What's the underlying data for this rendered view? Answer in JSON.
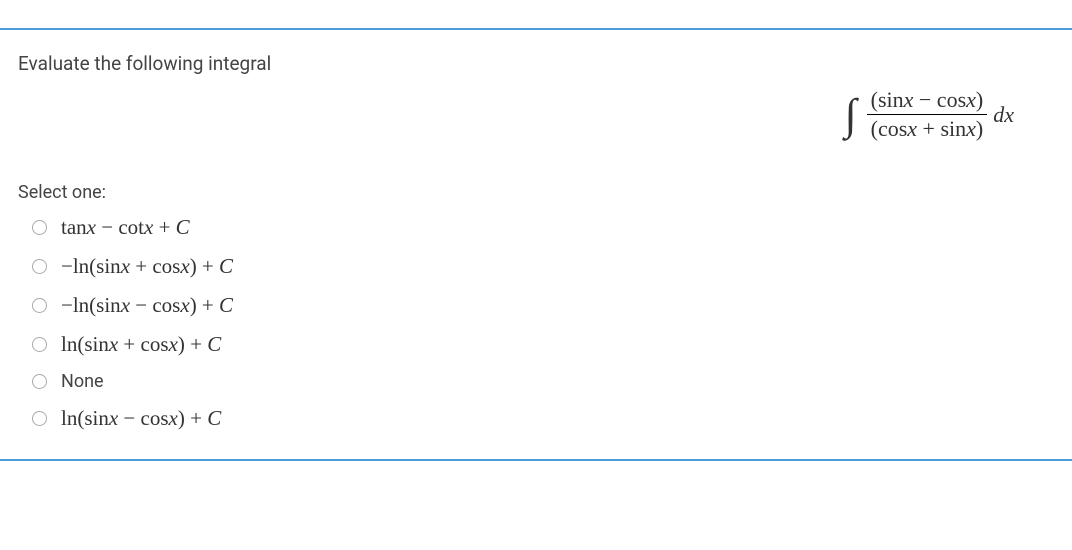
{
  "question": {
    "prompt": "Evaluate the following integral",
    "integral": {
      "numerator": "(sinx − cosx)",
      "denominator": "(cosx + sinx)",
      "differential": "dx"
    },
    "select_label": "Select one:",
    "options": [
      {
        "text": "tanx − cotx + C",
        "is_math": true
      },
      {
        "text": "−ln(sinx + cosx) + C",
        "is_math": true
      },
      {
        "text": "−ln(sinx − cosx) + C",
        "is_math": true
      },
      {
        "text": "ln(sinx + cosx) + C",
        "is_math": true
      },
      {
        "text": "None",
        "is_math": false
      },
      {
        "text": "ln(sinx − cosx) + C",
        "is_math": true
      }
    ]
  }
}
